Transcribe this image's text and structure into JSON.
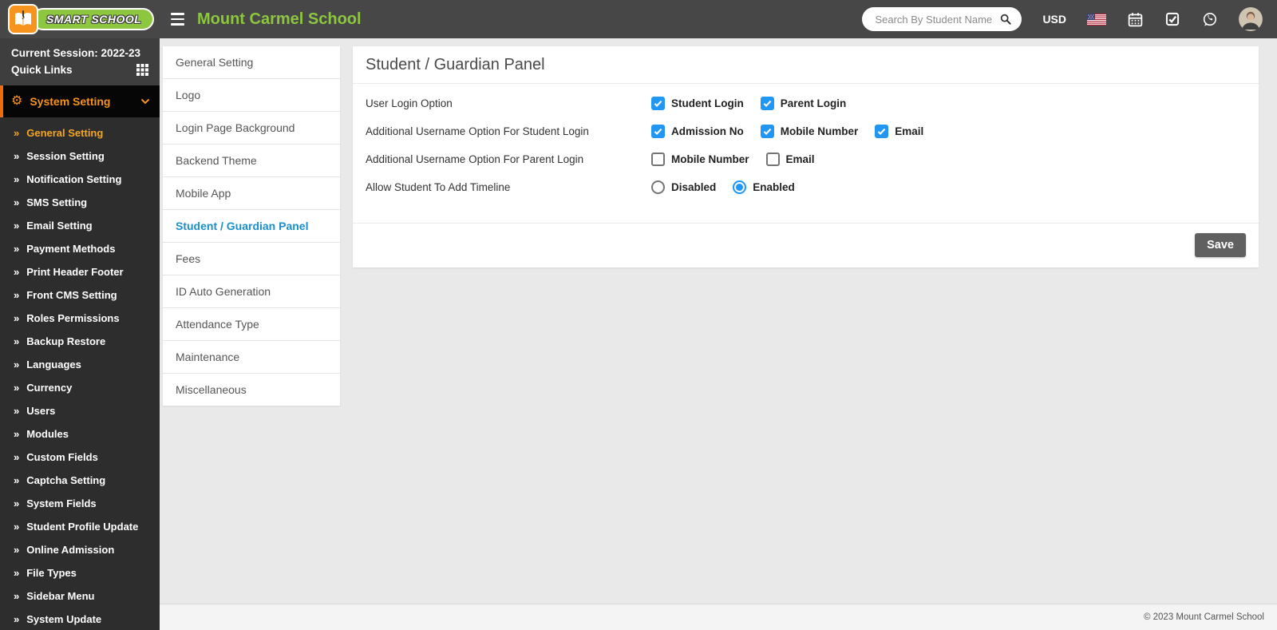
{
  "header": {
    "logo": {
      "brand": "SMART SCHOOL"
    },
    "title": "Mount Carmel School",
    "search": {
      "placeholder": "Search By Student Name"
    },
    "currency": "USD",
    "icons": [
      "hamburger-icon",
      "search-icon",
      "us-flag-icon",
      "calendar-icon",
      "tasks-icon",
      "whatsapp-icon",
      "user-avatar"
    ]
  },
  "sidebar": {
    "session_label": "Current Session: 2022-23",
    "quick_links_label": "Quick Links",
    "menu": {
      "label": "System Setting",
      "items": [
        {
          "label": "General Setting",
          "active": true
        },
        {
          "label": "Session Setting",
          "active": false
        },
        {
          "label": "Notification Setting",
          "active": false
        },
        {
          "label": "SMS Setting",
          "active": false
        },
        {
          "label": "Email Setting",
          "active": false
        },
        {
          "label": "Payment Methods",
          "active": false
        },
        {
          "label": "Print Header Footer",
          "active": false
        },
        {
          "label": "Front CMS Setting",
          "active": false
        },
        {
          "label": "Roles Permissions",
          "active": false
        },
        {
          "label": "Backup Restore",
          "active": false
        },
        {
          "label": "Languages",
          "active": false
        },
        {
          "label": "Currency",
          "active": false
        },
        {
          "label": "Users",
          "active": false
        },
        {
          "label": "Modules",
          "active": false
        },
        {
          "label": "Custom Fields",
          "active": false
        },
        {
          "label": "Captcha Setting",
          "active": false
        },
        {
          "label": "System Fields",
          "active": false
        },
        {
          "label": "Student Profile Update",
          "active": false
        },
        {
          "label": "Online Admission",
          "active": false
        },
        {
          "label": "File Types",
          "active": false
        },
        {
          "label": "Sidebar Menu",
          "active": false
        },
        {
          "label": "System Update",
          "active": false
        }
      ]
    }
  },
  "settings_nav": {
    "items": [
      {
        "label": "General Setting",
        "active": false
      },
      {
        "label": "Logo",
        "active": false
      },
      {
        "label": "Login Page Background",
        "active": false
      },
      {
        "label": "Backend Theme",
        "active": false
      },
      {
        "label": "Mobile App",
        "active": false
      },
      {
        "label": "Student / Guardian Panel",
        "active": true
      },
      {
        "label": "Fees",
        "active": false
      },
      {
        "label": "ID Auto Generation",
        "active": false
      },
      {
        "label": "Attendance Type",
        "active": false
      },
      {
        "label": "Maintenance",
        "active": false
      },
      {
        "label": "Miscellaneous",
        "active": false
      }
    ]
  },
  "panel": {
    "title": "Student / Guardian Panel",
    "rows": [
      {
        "label": "User Login Option",
        "type": "checkbox",
        "options": [
          {
            "label": "Student Login",
            "checked": true
          },
          {
            "label": "Parent Login",
            "checked": true
          }
        ]
      },
      {
        "label": "Additional Username Option For Student Login",
        "type": "checkbox",
        "options": [
          {
            "label": "Admission No",
            "checked": true
          },
          {
            "label": "Mobile Number",
            "checked": true
          },
          {
            "label": "Email",
            "checked": true
          }
        ]
      },
      {
        "label": "Additional Username Option For Parent Login",
        "type": "checkbox",
        "options": [
          {
            "label": "Mobile Number",
            "checked": false
          },
          {
            "label": "Email",
            "checked": false
          }
        ]
      },
      {
        "label": "Allow Student To Add Timeline",
        "type": "radio",
        "options": [
          {
            "label": "Disabled",
            "checked": false
          },
          {
            "label": "Enabled",
            "checked": true
          }
        ]
      }
    ],
    "save_label": "Save"
  },
  "footer": {
    "copyright": "© 2023 Mount Carmel School"
  },
  "colors": {
    "header_bg": "#474747",
    "sidebar_bg": "#2d2d2d",
    "session_bg": "#3e3e3e",
    "menu_head_bg": "#060606",
    "accent_orange": "#f7941d",
    "accent_orange_border": "#ee6b0c",
    "brand_green": "#8dc63f",
    "checkbox_blue": "#2196f3",
    "tab_active_blue": "#1a8fc9",
    "save_button_gray": "#606060",
    "main_bg": "#e9e9e9"
  }
}
